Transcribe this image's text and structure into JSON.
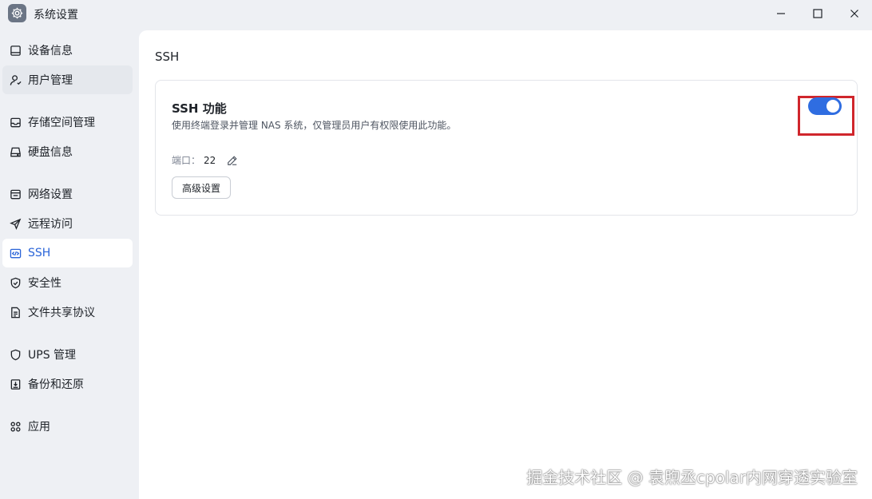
{
  "window": {
    "title": "系统设置",
    "app_icon": "gear-icon",
    "controls": [
      "minimize-icon",
      "maximize-icon",
      "close-icon"
    ]
  },
  "sidebar": {
    "items": [
      {
        "label": "设备信息",
        "icon": "device-icon"
      },
      {
        "label": "用户管理",
        "icon": "user-icon"
      },
      {
        "label": "存储空间管理",
        "icon": "storage-icon"
      },
      {
        "label": "硬盘信息",
        "icon": "disk-icon"
      },
      {
        "label": "网络设置",
        "icon": "network-icon"
      },
      {
        "label": "远程访问",
        "icon": "remote-icon"
      },
      {
        "label": "SSH",
        "icon": "code-icon"
      },
      {
        "label": "安全性",
        "icon": "shield-check-icon"
      },
      {
        "label": "文件共享协议",
        "icon": "file-icon"
      },
      {
        "label": "UPS 管理",
        "icon": "shield-icon"
      },
      {
        "label": "备份和还原",
        "icon": "backup-icon"
      },
      {
        "label": "应用",
        "icon": "apps-icon"
      }
    ],
    "active": "SSH"
  },
  "main": {
    "title": "SSH",
    "card": {
      "title": "SSH 功能",
      "description": "使用终端登录并管理 NAS 系统，仅管理员用户有权限使用此功能。",
      "port_label": "端口：",
      "port_value": "22",
      "advanced_button": "高级设置",
      "toggle_on": true
    }
  },
  "colors": {
    "accent": "#2f6de1",
    "highlight": "#d0262c",
    "sidebar_bg": "#eef0f4"
  },
  "watermark": "掘金技术社区 @ 袁煦丞cpolar内网穿透实验室"
}
